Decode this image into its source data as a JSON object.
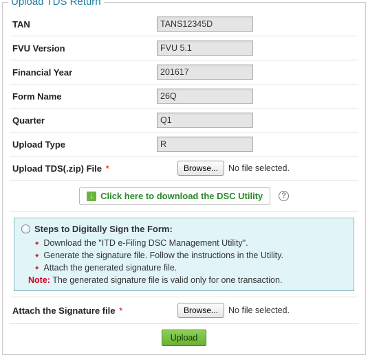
{
  "title": "Upload TDS Return",
  "fields": {
    "tan": {
      "label": "TAN",
      "value": "TANS12345D"
    },
    "fvu": {
      "label": "FVU Version",
      "value": "FVU 5.1"
    },
    "fy": {
      "label": "Financial Year",
      "value": "201617"
    },
    "form": {
      "label": "Form Name",
      "value": "26Q"
    },
    "quarter": {
      "label": "Quarter",
      "value": "Q1"
    },
    "upload_type": {
      "label": "Upload Type",
      "value": "R"
    },
    "tds_file": {
      "label": "Upload TDS(.zip) File",
      "browse": "Browse...",
      "status": "No file selected."
    },
    "sig_file": {
      "label": "Attach the Signature file",
      "browse": "Browse...",
      "status": "No file selected."
    }
  },
  "dsc": {
    "button": "Click here to download the DSC Utility",
    "help": "?"
  },
  "steps": {
    "title": "Steps to Digitally Sign the Form:",
    "items": [
      "Download the \"ITD e-Filing DSC Management Utility\".",
      "Generate the signature file. Follow the instructions in the Utility.",
      "Attach the generated signature file."
    ],
    "note_label": "Note:",
    "note_text": " The generated signature file is valid only for one transaction."
  },
  "upload_button": "Upload",
  "required_mark": " *"
}
